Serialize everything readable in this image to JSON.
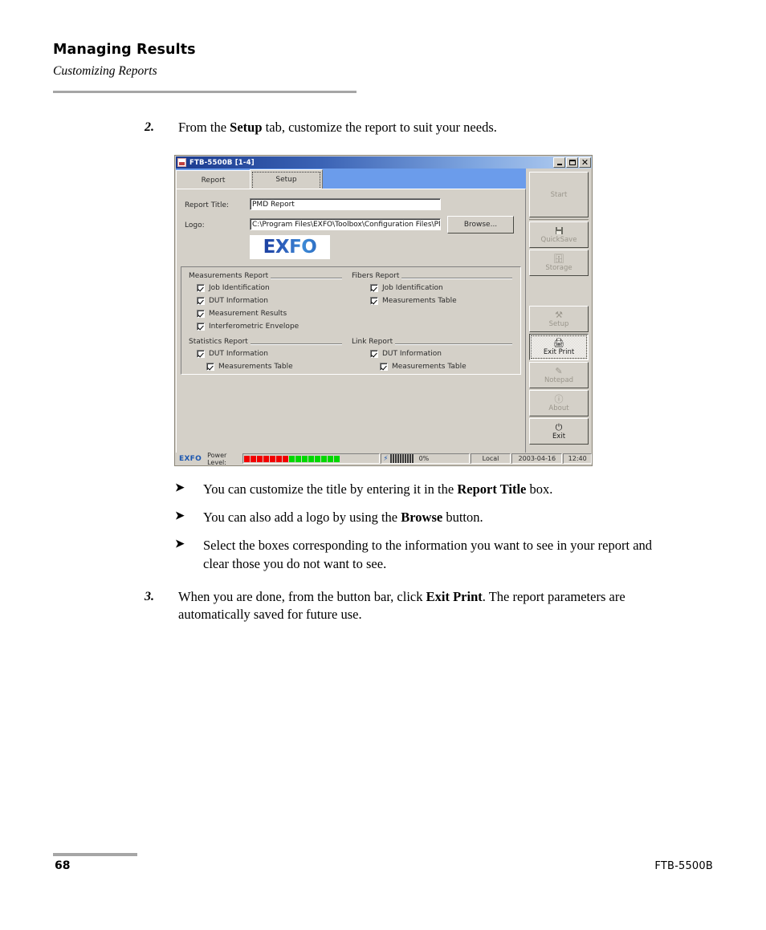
{
  "page": {
    "doc_title": "Managing Results",
    "doc_subtitle": "Customizing Reports",
    "page_number": "68",
    "footer_model": "FTB-5500B"
  },
  "steps": {
    "step2_num": "2.",
    "step2_text_pre": "From the ",
    "step2_bold": "Setup",
    "step2_text_post": " tab, customize the report to suit your needs.",
    "step3_num": "3.",
    "step3_text_pre": "When you are done, from the button bar, click ",
    "step3_bold": "Exit Print",
    "step3_text_post": ". The report parameters are automatically saved for future use."
  },
  "bullets": [
    {
      "arrow": "➤",
      "pre": "You can customize the title by entering it in the ",
      "bold": "Report Title",
      "post": " box."
    },
    {
      "arrow": "➤",
      "pre": "You can also add a logo by using the ",
      "bold": "Browse",
      "post": " button."
    },
    {
      "arrow": "➤",
      "pre": "Select the boxes corresponding to the information you want to see in your report and clear those you do not want to see.",
      "bold": "",
      "post": ""
    }
  ],
  "app": {
    "titlebar": {
      "title": "FTB-5500B [1-4]",
      "minimize_label": "_",
      "maximize_label": "□",
      "close_label": "✕"
    },
    "tabs": [
      {
        "label": "Report",
        "active": false
      },
      {
        "label": "Setup",
        "active": true
      }
    ],
    "fields": {
      "report_title_label": "Report Title:",
      "report_title_value": "PMD Report",
      "logo_label": "Logo:",
      "logo_value": "C:\\Program Files\\EXFO\\Toolbox\\Configuration Files\\PM",
      "browse_label": "Browse...",
      "logo_image_text": "EXFO"
    },
    "groups": [
      {
        "title": "Measurements Report",
        "items": [
          {
            "label": "Job Identification",
            "checked": true,
            "indent": 0
          },
          {
            "label": "DUT Information",
            "checked": true,
            "indent": 0
          },
          {
            "label": "Measurement Results",
            "checked": true,
            "indent": 0
          },
          {
            "label": "Interferometric Envelope",
            "checked": true,
            "indent": 0
          }
        ]
      },
      {
        "title": "Fibers Report",
        "items": [
          {
            "label": "Job Identification",
            "checked": true,
            "indent": 0
          },
          {
            "label": "Measurements Table",
            "checked": true,
            "indent": 0
          }
        ]
      },
      {
        "title": "Statistics Report",
        "items": [
          {
            "label": "DUT Information",
            "checked": true,
            "indent": 0
          },
          {
            "label": "Measurements Table",
            "checked": true,
            "indent": 1
          }
        ]
      },
      {
        "title": "Link Report",
        "items": [
          {
            "label": "DUT Information",
            "checked": true,
            "indent": 0
          },
          {
            "label": "Measurements Table",
            "checked": true,
            "indent": 1
          }
        ]
      }
    ],
    "buttonbar": [
      {
        "label": "Start",
        "icon": "",
        "state": "disabled",
        "selected": false
      },
      {
        "label": "QuickSave",
        "icon": "floppy-disk-icon",
        "state": "disabled",
        "selected": false
      },
      {
        "label": "Storage",
        "icon": "storage-icon",
        "state": "disabled",
        "selected": false
      },
      {
        "label": "Setup",
        "icon": "setup-tools-icon",
        "state": "disabled",
        "selected": false
      },
      {
        "label": "Exit Print",
        "icon": "printer-icon",
        "state": "enabled",
        "selected": true
      },
      {
        "label": "Notepad",
        "icon": "notepad-icon",
        "state": "disabled",
        "selected": false
      },
      {
        "label": "About",
        "icon": "about-info-icon",
        "state": "disabled",
        "selected": false
      },
      {
        "label": "Exit",
        "icon": "power-icon",
        "state": "enabled",
        "selected": false
      }
    ],
    "statusbar": {
      "brand": "EXFO",
      "power_label": "Power Level:",
      "power_red_segments": 7,
      "power_green_segments": 8,
      "progress_percent": "0%",
      "progress_segments": 10,
      "location": "Local",
      "date": "2003-04-16",
      "time": "12:40"
    }
  },
  "colors": {
    "titlebar_dark": "#1a3a8f",
    "titlebar_light": "#b9d2f2",
    "tabstrip_blue": "#6b9ceb",
    "dialog_face": "#d4d0c8",
    "brand_blue": "#1b56b0",
    "rule_gray": "#a6a6a6",
    "power_red": "#f20000",
    "power_green": "#00d800"
  }
}
